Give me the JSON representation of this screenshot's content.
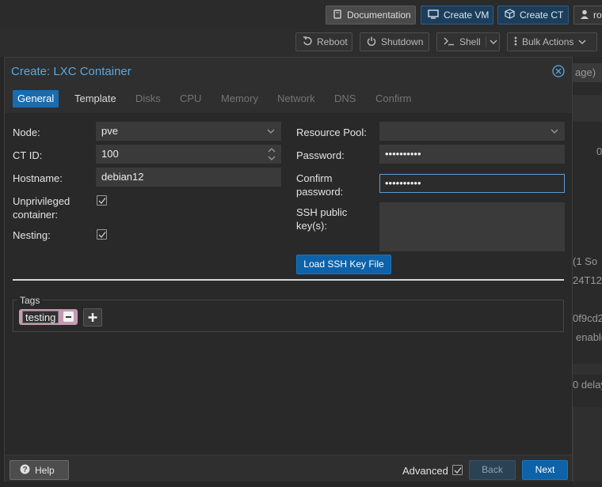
{
  "topbar": {
    "documentation_label": "Documentation",
    "create_vm_label": "Create VM",
    "create_ct_label": "Create CT",
    "user_label": "ro"
  },
  "node_toolbar": {
    "reboot_label": "Reboot",
    "shutdown_label": "Shutdown",
    "shell_label": "Shell",
    "bulk_actions_label": "Bulk Actions"
  },
  "background_fragments": [
    "age)",
    "0",
    "(1 So",
    "24T12",
    "0f9cd2",
    "enable",
    "0 delay"
  ],
  "dialog": {
    "title": "Create: LXC Container",
    "tabs": [
      {
        "label": "General",
        "state": "active"
      },
      {
        "label": "Template",
        "state": "normal"
      },
      {
        "label": "Disks",
        "state": "disabled"
      },
      {
        "label": "CPU",
        "state": "disabled"
      },
      {
        "label": "Memory",
        "state": "disabled"
      },
      {
        "label": "Network",
        "state": "disabled"
      },
      {
        "label": "DNS",
        "state": "disabled"
      },
      {
        "label": "Confirm",
        "state": "disabled"
      }
    ],
    "left": {
      "node_label": "Node:",
      "node_value": "pve",
      "ctid_label": "CT ID:",
      "ctid_value": "100",
      "hostname_label": "Hostname:",
      "hostname_value": "debian12",
      "unprivileged_label_line1": "Unprivileged",
      "unprivileged_label_line2": "container:",
      "unprivileged_checked": true,
      "nesting_label": "Nesting:",
      "nesting_checked": true
    },
    "right": {
      "pool_label": "Resource Pool:",
      "pool_value": "",
      "password_label": "Password:",
      "password_value": "••••••••••",
      "confirm_label_line1": "Confirm",
      "confirm_label_line2": "password:",
      "confirm_value": "••••••••••",
      "ssh_label_line1": "SSH public",
      "ssh_label_line2": "key(s):",
      "ssh_value": "",
      "load_ssh_button": "Load SSH Key File"
    },
    "tags": {
      "legend": "Tags",
      "items": [
        "testing"
      ],
      "tag_color": "#c59ab3"
    },
    "footer": {
      "help_label": "Help",
      "advanced_label": "Advanced",
      "advanced_checked": true,
      "back_label": "Back",
      "next_label": "Next"
    }
  },
  "colors": {
    "accent": "#1a6cb0",
    "title": "#5aa7e2",
    "button_primary": "#0d62a8"
  }
}
